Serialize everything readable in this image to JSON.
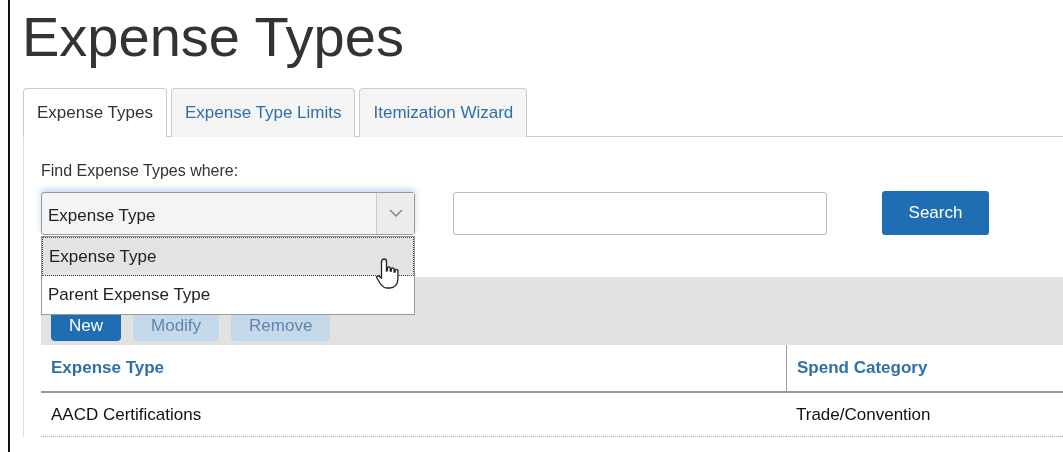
{
  "title": "Expense Types",
  "tabs": [
    {
      "label": "Expense Types",
      "selected": true
    },
    {
      "label": "Expense Type Limits",
      "selected": false
    },
    {
      "label": "Itemization Wizard",
      "selected": false
    }
  ],
  "search": {
    "label": "Find Expense Types where:",
    "field": {
      "value": "Expense Type",
      "expanded": true,
      "options": [
        {
          "label": "Expense Type",
          "selected": true
        },
        {
          "label": "Parent Expense Type",
          "selected": false
        }
      ]
    },
    "button": "Search"
  },
  "toolbar": [
    {
      "label": "New",
      "disabled": false
    },
    {
      "label": "Modify",
      "disabled": true
    },
    {
      "label": "Remove",
      "disabled": true
    }
  ],
  "table": {
    "columns": [
      "Expense Type",
      "Spend Category"
    ],
    "rows": [
      [
        "AACD Certifications",
        "Trade/Convention"
      ]
    ]
  }
}
